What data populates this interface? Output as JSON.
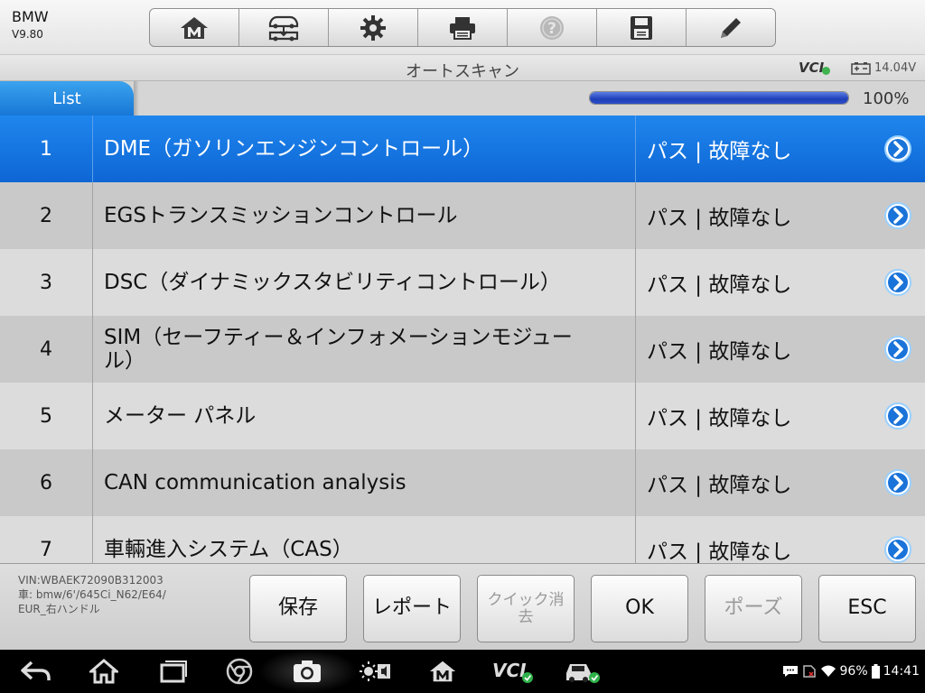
{
  "app": {
    "brand": "BMW",
    "version": "V9.80"
  },
  "toolbar": [
    {
      "icon": "home-m-icon"
    },
    {
      "icon": "vehicle-swap-icon"
    },
    {
      "icon": "gear-icon"
    },
    {
      "icon": "printer-icon"
    },
    {
      "icon": "help-icon"
    },
    {
      "icon": "save-icon"
    },
    {
      "icon": "edit-icon"
    }
  ],
  "titlebar": {
    "title": "オートスキャン",
    "vci_label": "VCI",
    "voltage": "14.04V"
  },
  "tab": {
    "label": "List"
  },
  "progress": {
    "value": 1.0,
    "label": "100%"
  },
  "rows": [
    {
      "num": "1",
      "name": "DME（ガソリンエンジンコントロール）",
      "status": "パス | 故障なし"
    },
    {
      "num": "2",
      "name": "EGSトランスミッションコントロール",
      "status": "パス | 故障なし"
    },
    {
      "num": "3",
      "name": "DSC（ダイナミックスタビリティコントロール）",
      "status": "パス | 故障なし"
    },
    {
      "num": "4",
      "name": "SIM（セーフティー＆インフォメーションモジュール）",
      "name_line1": "SIM（セーフティー＆インフォメーションモジュー",
      "name_line2": "ル）",
      "status": "パス | 故障なし"
    },
    {
      "num": "5",
      "name": "メーター パネル",
      "status": "パス | 故障なし"
    },
    {
      "num": "6",
      "name": "CAN communication analysis",
      "status": "パス | 故障なし"
    },
    {
      "num": "7",
      "name": "車輛進入システム（CAS）",
      "status": "パス | 故障なし"
    }
  ],
  "vehicle": {
    "vin": "VIN:WBAEK72090B312003",
    "path_line1": "車: bmw/6'/645Ci_N62/E64/",
    "path_line2": "EUR_右ハンドル"
  },
  "actions": {
    "save": "保存",
    "report": "レポート",
    "quick_clear": "クイック消去",
    "quick_clear_line1": "クイック消",
    "quick_clear_line2": "去",
    "ok": "OK",
    "pause": "ポーズ",
    "esc": "ESC"
  },
  "status_bar": {
    "battery": "96%",
    "time": "14:41"
  },
  "colors": {
    "accent": "#1877d6",
    "selected_row": "#0e66d4",
    "ok_green": "#3fb34f"
  }
}
